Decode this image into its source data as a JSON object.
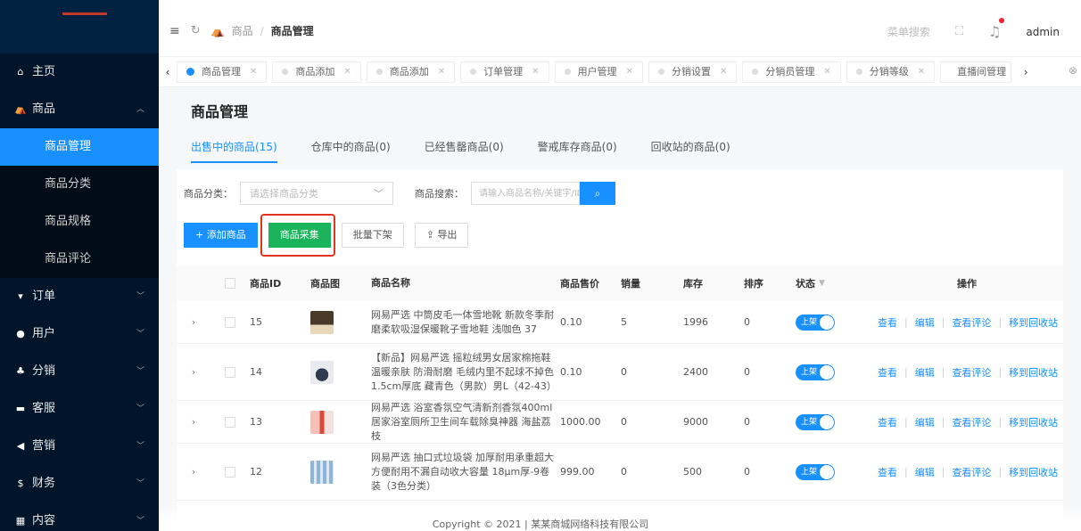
{
  "header": {
    "menu_icon": "menu-fold-icon",
    "refresh_icon": "refresh-icon",
    "home_icon": "shop-icon",
    "breadcrumb": [
      "商品",
      "商品管理"
    ],
    "search_placeholder": "菜单搜索",
    "user": "admin"
  },
  "sidebar": {
    "items": [
      {
        "label": "主页",
        "icon": "home-icon"
      },
      {
        "label": "商品",
        "icon": "shop-icon"
      },
      {
        "label": "订单",
        "icon": "cart-icon"
      },
      {
        "label": "用户",
        "icon": "user-icon"
      },
      {
        "label": "分销",
        "icon": "share-icon"
      },
      {
        "label": "客服",
        "icon": "chat-icon"
      },
      {
        "label": "营销",
        "icon": "send-icon"
      },
      {
        "label": "财务",
        "icon": "dollar-icon"
      },
      {
        "label": "内容",
        "icon": "book-icon"
      }
    ],
    "subitems": [
      "商品管理",
      "商品分类",
      "商品规格",
      "商品评论"
    ]
  },
  "tabs": [
    "商品管理",
    "商品添加",
    "商品添加",
    "订单管理",
    "用户管理",
    "分销设置",
    "分销员管理",
    "分销等级",
    "直播间管理"
  ],
  "page": {
    "title": "商品管理",
    "tabs": [
      "出售中的商品(15)",
      "仓库中的商品(0)",
      "已经售罄商品(0)",
      "警戒库存商品(0)",
      "回收站的商品(0)"
    ],
    "filter": {
      "category_label": "商品分类：",
      "category_placeholder": "请选择商品分类",
      "search_label": "商品搜索：",
      "search_placeholder": "请输入商品名称/关键字/ID"
    },
    "buttons": {
      "add": "+ 添加商品",
      "collect": "商品采集",
      "batch_off": "批量下架",
      "export": "导出"
    },
    "columns": [
      "商品ID",
      "商品图",
      "商品名称",
      "商品售价",
      "销量",
      "库存",
      "排序",
      "状态",
      "操作"
    ],
    "rows": [
      {
        "id": "15",
        "name": "网易严选 中筒皮毛一体雪地靴 新款冬季耐磨柔软吸湿保暖靴子雪地鞋 浅咖色 37",
        "price": "0.10",
        "sales": "5",
        "stock": "1996",
        "sort": "0",
        "status": "上架"
      },
      {
        "id": "14",
        "name": "【新品】网易严选 摇粒绒男女居家棉拖鞋 温暖亲肤 防滑耐磨 毛绒内里不起球不掉色 1.5cm厚底 藏青色（男款）男L（42-43）",
        "price": "0.10",
        "sales": "0",
        "stock": "2400",
        "sort": "0",
        "status": "上架"
      },
      {
        "id": "13",
        "name": "网易严选 浴室香氛空气清新剂香氛400ml 居家浴室厕所卫生间车载除臭神器 海盐荔枝",
        "price": "1000.00",
        "sales": "0",
        "stock": "9000",
        "sort": "0",
        "status": "上架"
      },
      {
        "id": "12",
        "name": "网易严选 抽口式垃圾袋 加厚耐用承重超大方便耐用不漏自动收大容量 18μm厚-9卷装（3色分类）",
        "price": "999.00",
        "sales": "0",
        "stock": "500",
        "sort": "0",
        "status": "上架"
      }
    ],
    "ops": [
      "查看",
      "编辑",
      "查看评论",
      "移到回收站"
    ]
  },
  "footer": "Copyright © 2021 | 某某商城网络科技有限公司"
}
